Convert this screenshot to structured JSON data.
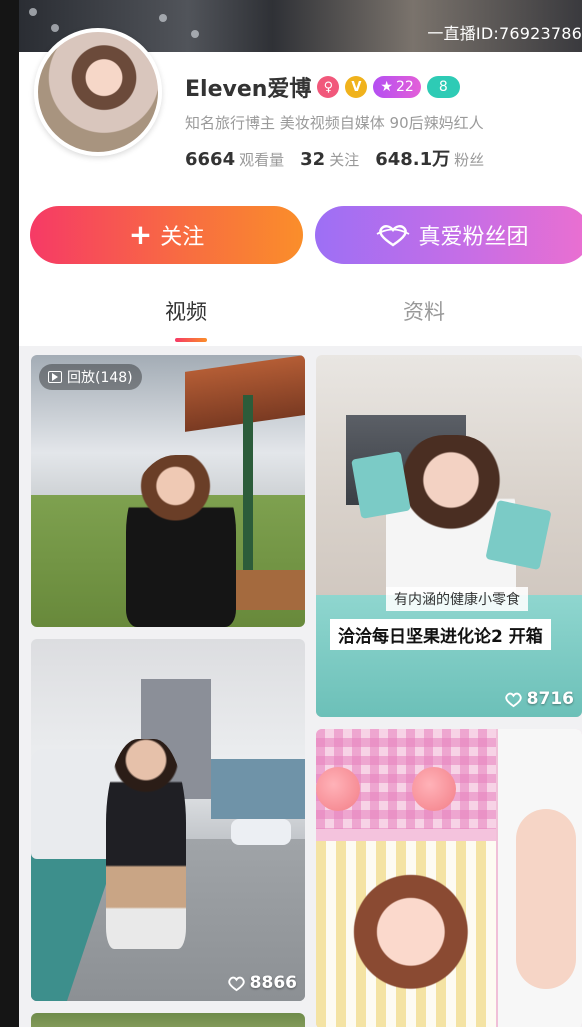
{
  "header": {
    "live_id": "一直播ID:76923786"
  },
  "profile": {
    "name": "Eleven爱博",
    "badges": {
      "gender_symbol": "♀",
      "verified_symbol": "V",
      "level": "22",
      "fan_level": "8"
    },
    "bio": "知名旅行博主 美妆视频自媒体 90后辣妈红人",
    "stats": [
      {
        "value": "6664",
        "label": "观看量"
      },
      {
        "value": "32",
        "label": "关注"
      },
      {
        "value": "648.1万",
        "label": "粉丝"
      }
    ]
  },
  "actions": {
    "follow_label": "关注",
    "fan_club_label": "真爱粉丝团"
  },
  "tabs": [
    {
      "label": "视频",
      "active": true
    },
    {
      "label": "资料",
      "active": false
    }
  ],
  "videos": [
    {
      "replay_label": "回放(148)"
    },
    {
      "overlay_line1": "有内涵的健康小零食",
      "overlay_line2": "洽洽每日坚果进化论2 开箱",
      "likes": "8716"
    },
    {
      "likes": "8866"
    },
    {}
  ],
  "colors": {
    "follow_gradient": [
      "#f63a66",
      "#fa8e2a"
    ],
    "fan_club_gradient": [
      "#9d6ff5",
      "#eb6fd0"
    ],
    "muted_text": "#999999"
  },
  "icons": {
    "plus": "plus-icon",
    "heart": "heart-icon",
    "play": "play-icon"
  }
}
